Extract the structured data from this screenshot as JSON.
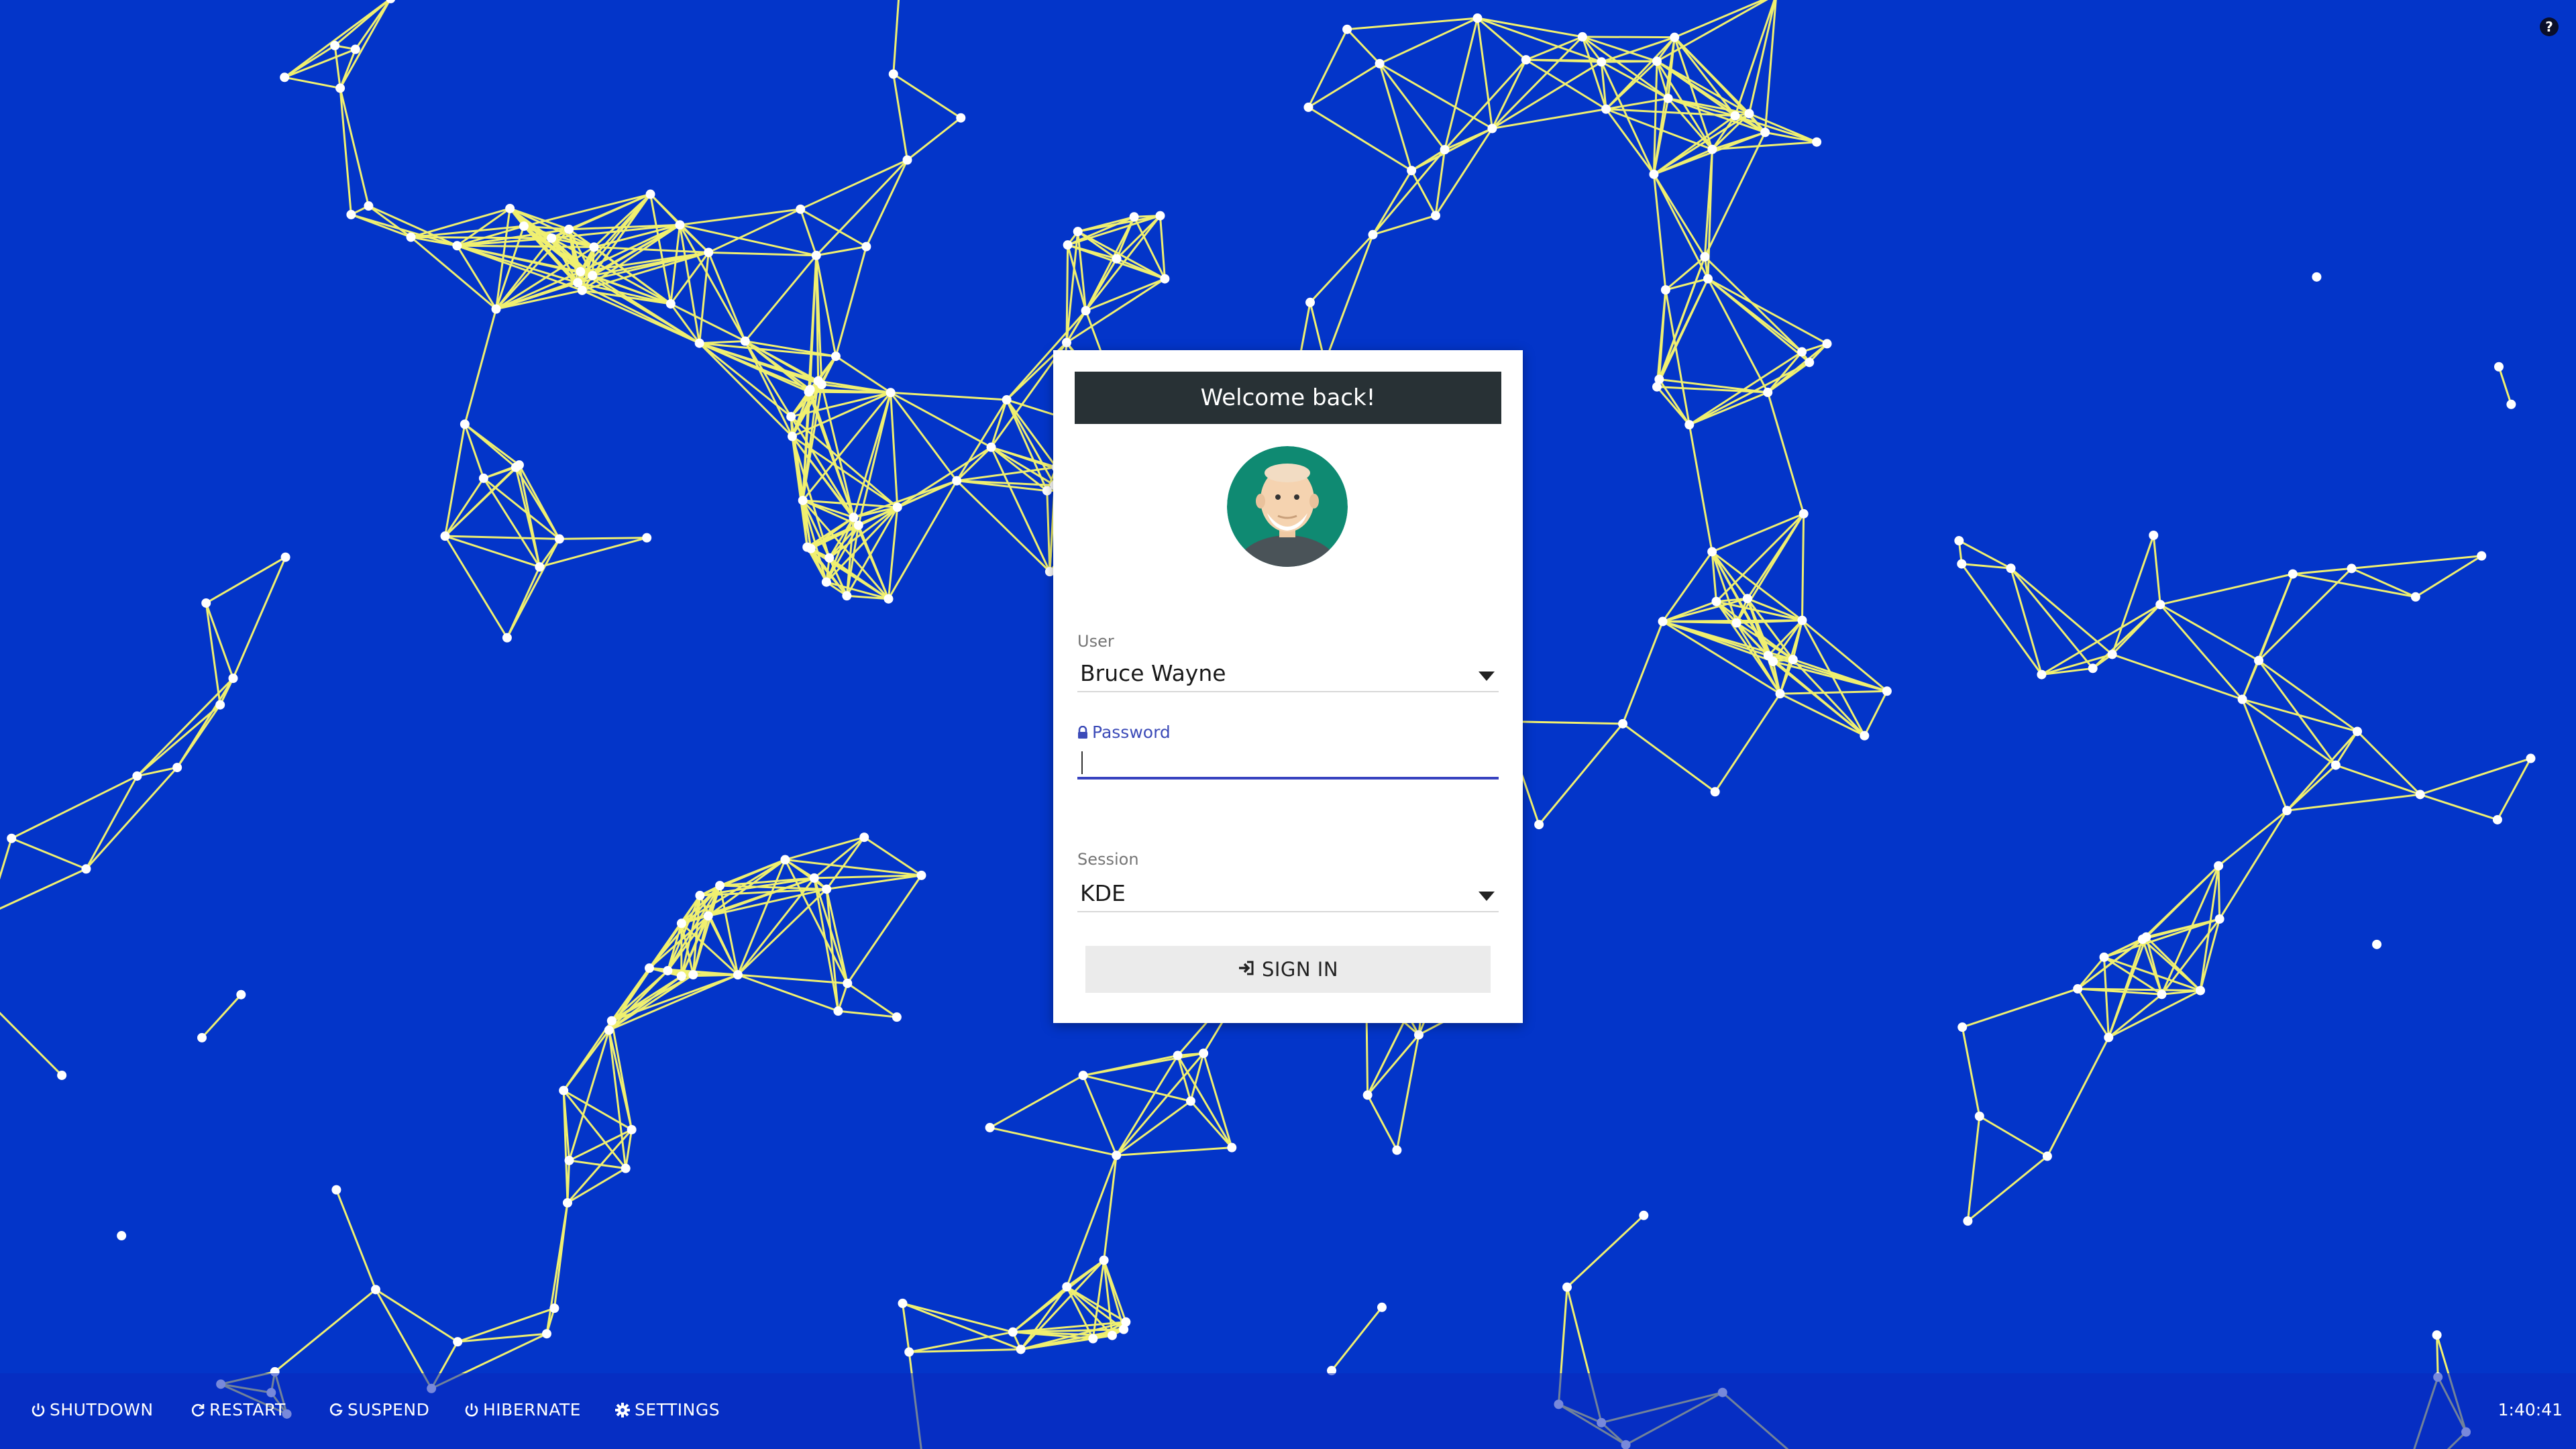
{
  "login": {
    "greeting": "Welcome back!",
    "user_label": "User",
    "user_value": "Bruce Wayne",
    "password_label": "Password",
    "password_value": "",
    "session_label": "Session",
    "session_value": "KDE",
    "signin_label": "SIGN IN"
  },
  "help": {
    "label": "?"
  },
  "taskbar": {
    "shutdown": "SHUTDOWN",
    "restart": "RESTART",
    "suspend": "SUSPEND",
    "hibernate": "HIBERNATE",
    "settings": "SETTINGS",
    "clock": "1:40:41"
  },
  "icons": {
    "shutdown": "power-icon",
    "restart": "refresh-icon",
    "suspend": "moon-g-icon",
    "hibernate": "power-icon",
    "settings": "gear-icon",
    "password": "lock-icon",
    "signin": "sign-in-icon"
  },
  "colors": {
    "background": "#0335c9",
    "network_lines": "#f0f070",
    "network_nodes": "#ffffff",
    "header": "#283135",
    "accent": "#3843c0"
  }
}
